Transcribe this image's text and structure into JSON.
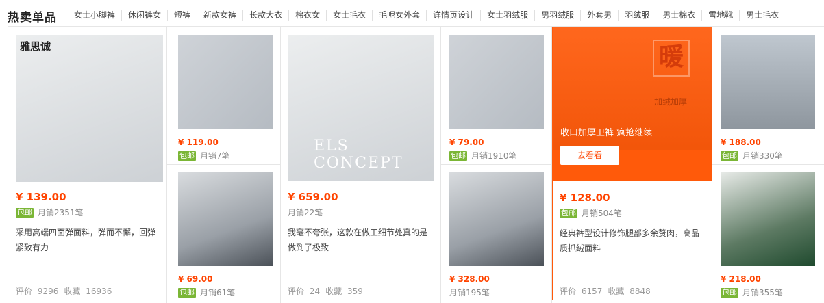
{
  "nav": {
    "title": "热卖单品",
    "tabs": [
      "女士小脚裤",
      "休闲裤女",
      "短裤",
      "新款女裤",
      "长款大衣",
      "棉衣女",
      "女士毛衣",
      "毛呢女外套",
      "详情页设计",
      "女士羽绒服",
      "男羽绒服",
      "外套男",
      "羽绒服",
      "男士棉衣",
      "雪地靴",
      "男士毛衣"
    ]
  },
  "badge_label": "包邮",
  "stats_labels": {
    "rating": "评价",
    "favorite": "收藏"
  },
  "products": {
    "p1": {
      "caption": "雅思诚",
      "price": "¥ 139.00",
      "sales": "月销2351笔",
      "desc": "采用高端四面弹面料，弹而不懈，回弹紧致有力",
      "rating": "9296",
      "favorites": "16936"
    },
    "p2": {
      "price": "¥ 119.00",
      "sales": "月销7笔"
    },
    "p3": {
      "price": "¥ 69.00",
      "sales": "月销61笔"
    },
    "p4": {
      "brand": "ELS CONCEPT",
      "price": "¥ 659.00",
      "sales": "月销22笔",
      "desc": "我毫不夸张，这款在做工细节处真的是做到了极致",
      "rating": "24",
      "favorites": "359"
    },
    "p5": {
      "price": "¥ 79.00",
      "sales": "月销1910笔"
    },
    "p6": {
      "price": "¥ 328.00",
      "sales": "月销195笔"
    },
    "p7": {
      "promo_char": "暖",
      "promo_tag": "加绒加厚",
      "promo_text": "收口加厚卫裤 疯抢继续",
      "promo_button": "去看看",
      "price": "¥ 128.00",
      "sales": "月销504笔",
      "desc": "经典裤型设计修饰腿部多余赘肉，高品质抓绒面料",
      "rating": "6157",
      "favorites": "8848"
    },
    "p8": {
      "price": "¥ 188.00",
      "sales": "月销330笔"
    },
    "p9": {
      "price": "¥ 218.00",
      "sales": "月销355笔"
    }
  },
  "colors": {
    "price": "#ff4400",
    "badge": "#7bb636",
    "promo": "#ff5a0a"
  }
}
